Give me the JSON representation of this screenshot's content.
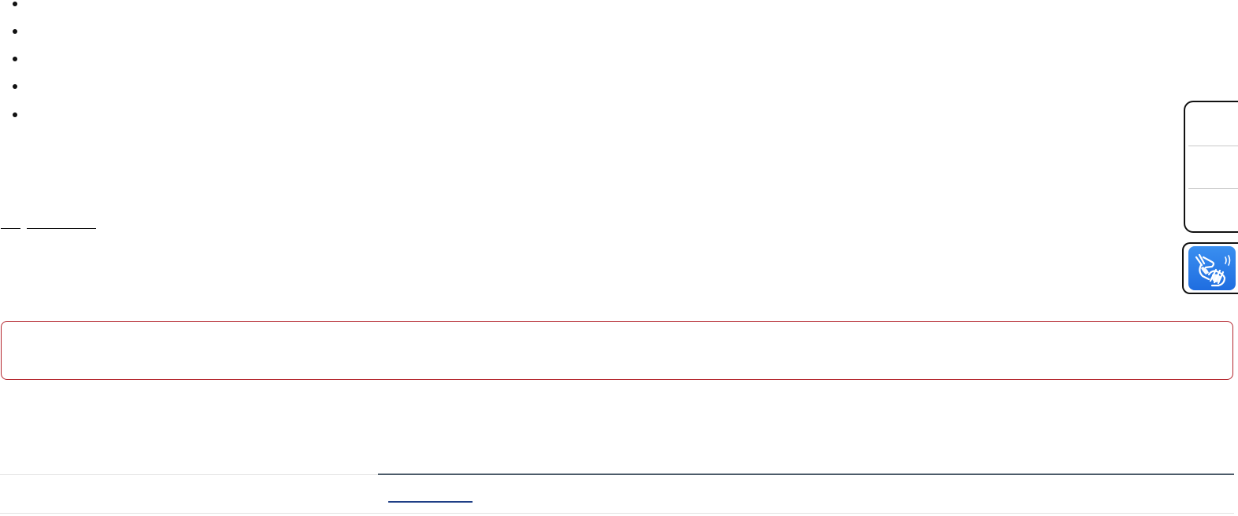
{
  "bullet_list": {
    "items": [
      "",
      "",
      "",
      "",
      ""
    ]
  },
  "links": {
    "short_link": "",
    "long_link": ""
  },
  "side_toolbar": {
    "buttons": [
      "",
      "",
      ""
    ]
  },
  "sign_language_widget": {
    "icon": "sign-language-hands-icon",
    "accent_color": "#2b7be8"
  },
  "alert": {
    "message": "",
    "border_color": "#b3242c"
  },
  "footer": {
    "link_text": "",
    "rule_color": "#4c5b69",
    "link_color": "#1f3f86"
  }
}
